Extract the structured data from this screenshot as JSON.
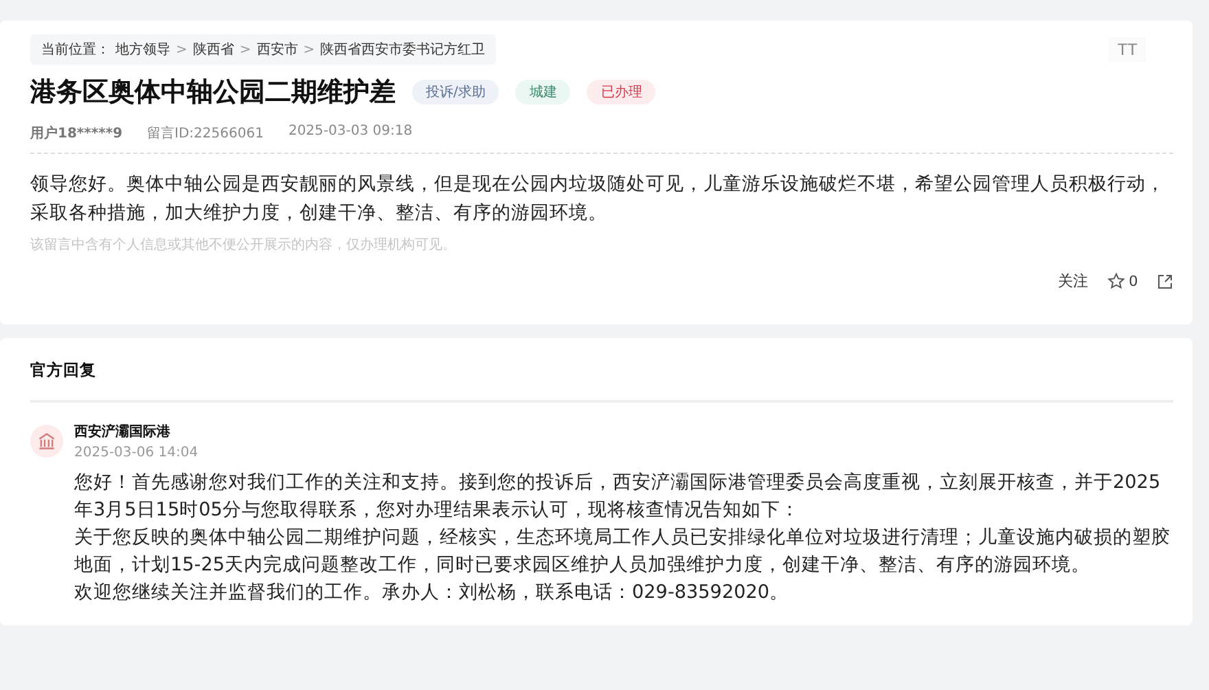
{
  "breadcrumb": {
    "label": "当前位置：",
    "items": [
      "地方领导",
      "陕西省",
      "西安市",
      "陕西省西安市委书记方红卫"
    ],
    "separator": ">"
  },
  "font_size_button": "TT",
  "post": {
    "title": "港务区奥体中轴公园二期维护差",
    "tags": [
      {
        "label": "投诉/求助",
        "kind": "type"
      },
      {
        "label": "城建",
        "kind": "field"
      },
      {
        "label": "已办理",
        "kind": "status"
      }
    ],
    "user": "用户18*****9",
    "message_id": "留言ID:22566061",
    "time": "2025-03-03 09:18",
    "body": "领导您好。奥体中轴公园是西安靓丽的风景线，但是现在公园内垃圾随处可见，儿童游乐设施破烂不堪，希望公园管理人员积极行动，采取各种措施，加大维护力度，创建干净、整洁、有序的游园环境。",
    "privacy_note": "该留言中含有个人信息或其他不便公开展示的内容，仅办理机构可见。",
    "follow": "关注",
    "star_count": "0"
  },
  "reply": {
    "heading": "官方回复",
    "org": "西安浐灞国际港",
    "time": "2025-03-06 14:04",
    "paragraphs": [
      "您好！首先感谢您对我们工作的关注和支持。接到您的投诉后，西安浐灞国际港管理委员会高度重视，立刻展开核查，并于2025年3月5日15时05分与您取得联系，您对办理结果表示认可，现将核查情况告知如下：",
      "关于您反映的奥体中轴公园二期维护问题，经核实，生态环境局工作人员已安排绿化单位对垃圾进行清理；儿童设施内破损的塑胶地面，计划15-25天内完成问题整改工作，同时已要求园区维护人员加强维护力度，创建干净、整洁、有序的游园环境。",
      "欢迎您继续关注并监督我们的工作。承办人：刘松杨，联系电话：029-83592020。"
    ]
  }
}
